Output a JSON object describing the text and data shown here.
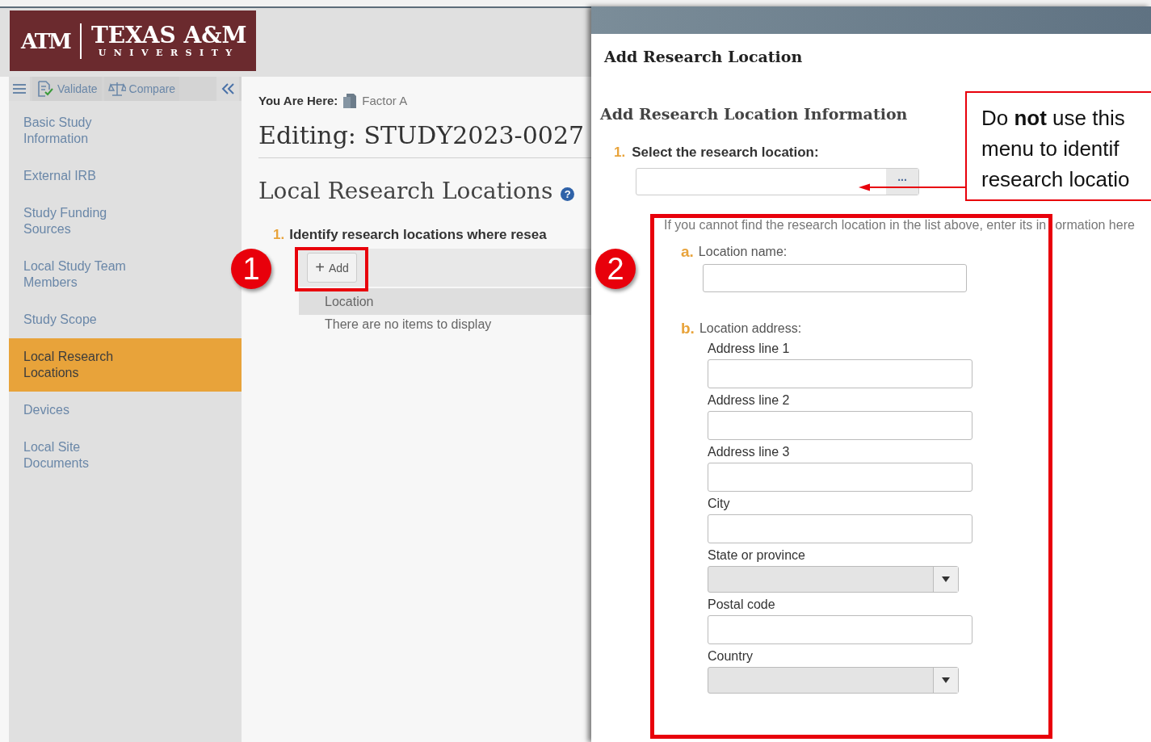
{
  "logo": {
    "monogram": "ATM",
    "wordmark": "TEXAS A&M",
    "subtitle": "UNIVERSITY"
  },
  "sidebar": {
    "toolbar": [
      {
        "label": "Validate",
        "kind": "validate"
      },
      {
        "label": "Compare",
        "kind": "compare"
      }
    ],
    "items": [
      {
        "label": "Basic Study Information",
        "selected": false
      },
      {
        "label": "External IRB",
        "selected": false
      },
      {
        "label": "Study Funding Sources",
        "selected": false
      },
      {
        "label": "Local Study Team Members",
        "selected": false
      },
      {
        "label": "Study Scope",
        "selected": false
      },
      {
        "label": "Local Research Locations",
        "selected": true
      },
      {
        "label": "Devices",
        "selected": false
      },
      {
        "label": "Local Site Documents",
        "selected": false
      }
    ]
  },
  "breadcrumb": {
    "label": "You Are Here:",
    "item": "Factor A"
  },
  "page_title": "Editing: STUDY2023-0027",
  "section": {
    "title": "Local Research Locations",
    "help": "?"
  },
  "question": {
    "number": "1.",
    "text": "Identify research locations where resea"
  },
  "add_button": {
    "icon": "+",
    "label": "Add"
  },
  "table": {
    "columns": [
      "Location"
    ],
    "empty_text": "There are no items to display"
  },
  "dialog": {
    "title": "Add Research Location",
    "heading": "Add Research Location Information",
    "select_question": {
      "number": "1.",
      "text": "Select the research location:",
      "button": "..."
    },
    "note": [
      "If you cannot find the research location in the list above, enter its in",
      "ormation here"
    ],
    "name_field": {
      "number": "a.",
      "label": "Location name:"
    },
    "address": {
      "number": "b.",
      "label": "Location address:",
      "fields": [
        {
          "label": "Address line 1",
          "kind": "text"
        },
        {
          "label": "Address line 2",
          "kind": "text"
        },
        {
          "label": "Address line 3",
          "kind": "text"
        },
        {
          "label": "City",
          "kind": "text"
        },
        {
          "label": "State or province",
          "kind": "select"
        },
        {
          "label": "Postal code",
          "kind": "text"
        },
        {
          "label": "Country",
          "kind": "select"
        }
      ]
    }
  },
  "annotations": {
    "badges": [
      "1",
      "2"
    ],
    "callout": [
      "Do **not** use this",
      "menu to identif",
      "research locatio"
    ]
  }
}
